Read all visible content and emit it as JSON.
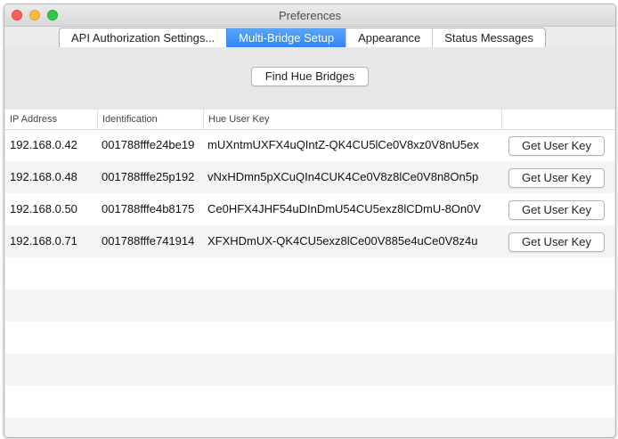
{
  "window": {
    "title": "Preferences"
  },
  "tabs": [
    {
      "label": "API Authorization Settings...",
      "active": false
    },
    {
      "label": "Multi-Bridge Setup",
      "active": true
    },
    {
      "label": "Appearance",
      "active": false
    },
    {
      "label": "Status Messages",
      "active": false
    }
  ],
  "toolbar": {
    "find_label": "Find Hue Bridges"
  },
  "table": {
    "columns": [
      "IP Address",
      "Identification",
      "Hue User Key",
      ""
    ],
    "rows": [
      {
        "ip": "192.168.0.42",
        "id": "001788fffe24be19",
        "key": "mUXntmUXFX4uQIntZ-QK4CU5lCe0V8xz0V8nU5ex",
        "button": "Get User Key"
      },
      {
        "ip": "192.168.0.48",
        "id": "001788fffe25p192",
        "key": "vNxHDmn5pXCuQIn4CUK4Ce0V8z8lCe0V8n8On5p",
        "button": "Get User Key"
      },
      {
        "ip": "192.168.0.50",
        "id": "001788fffe4b8175",
        "key": "Ce0HFX4JHF54uDInDmU54CU5exz8lCDmU-8On0V",
        "button": "Get User Key"
      },
      {
        "ip": "192.168.0.71",
        "id": "001788fffe741914",
        "key": "XFXHDmUX-QK4CU5exz8lCe00V885e4uCe0V8z4u",
        "button": "Get User Key"
      }
    ]
  },
  "colors": {
    "accent": "#2d83f6",
    "stripe": "#f4f4f4"
  }
}
